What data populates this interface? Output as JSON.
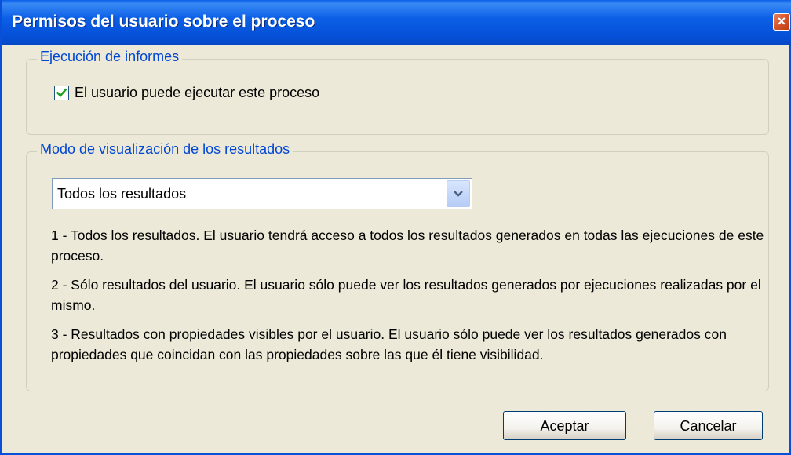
{
  "window": {
    "title": "Permisos del usuario sobre el proceso",
    "close_label": "×"
  },
  "execution_group": {
    "legend": "Ejecución de informes",
    "checkbox_label": "El usuario puede ejecutar este proceso",
    "checked": true
  },
  "display_group": {
    "legend": "Modo de visualización de los resultados",
    "select_value": "Todos los resultados",
    "descriptions": [
      "1 -  Todos los resultados. El usuario tendrá acceso a todos los resultados generados en todas las ejecuciones de este proceso.",
      "2 -  Sólo resultados del usuario. El usuario sólo puede ver los resultados generados por ejecuciones realizadas por el mismo.",
      "3 - Resultados con propiedades visibles por el usuario. El usuario sólo puede ver los resultados generados con propiedades que coincidan con las propiedades sobre las que él tiene visibilidad."
    ]
  },
  "buttons": {
    "accept": "Aceptar",
    "cancel": "Cancelar"
  },
  "colors": {
    "titlebar": "#0a5fe8",
    "legend_text": "#0046d5",
    "dialog_bg": "#ece9d8",
    "close_button": "#d4532a"
  }
}
